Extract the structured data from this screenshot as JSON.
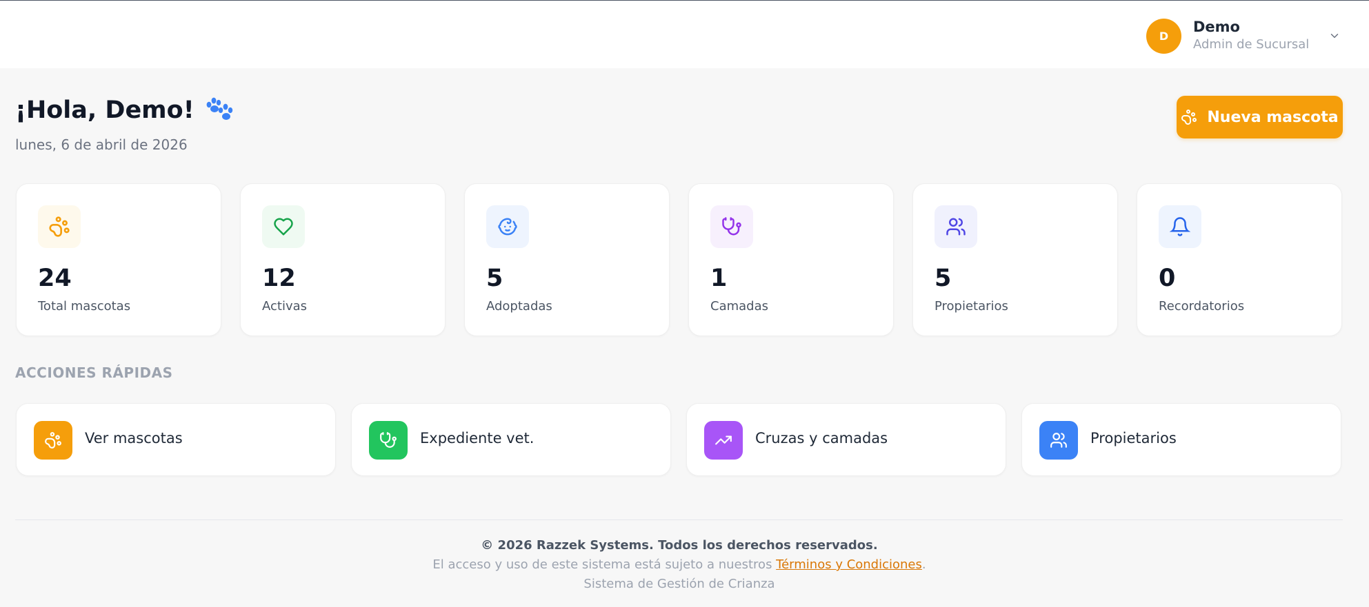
{
  "user": {
    "initial": "D",
    "name": "Demo",
    "role": "Admin de Sucursal"
  },
  "header": {
    "greeting": "¡Hola, Demo!",
    "date": "lunes, 6 de abril de 2026",
    "new_button_label": "Nueva mascota"
  },
  "stats": [
    {
      "value": "24",
      "label": "Total mascotas",
      "icon": "paw-icon",
      "color": "#f59e0b",
      "bg": "#fef9ec"
    },
    {
      "value": "12",
      "label": "Activas",
      "icon": "heart-icon",
      "color": "#16a34a",
      "bg": "#effaf2"
    },
    {
      "value": "5",
      "label": "Adoptadas",
      "icon": "baby-face-icon",
      "color": "#3b82f6",
      "bg": "#eef4fe"
    },
    {
      "value": "1",
      "label": "Camadas",
      "icon": "stethoscope-icon",
      "color": "#9333ea",
      "bg": "#f7f0fd"
    },
    {
      "value": "5",
      "label": "Propietarios",
      "icon": "users-icon",
      "color": "#4f46e5",
      "bg": "#f0f1fd"
    },
    {
      "value": "0",
      "label": "Recordatorios",
      "icon": "bell-icon",
      "color": "#2563eb",
      "bg": "#eef4fe"
    }
  ],
  "quick_actions": {
    "title": "ACCIONES RÁPIDAS",
    "items": [
      {
        "label": "Ver mascotas",
        "icon": "paw-icon",
        "color": "#f59e0b"
      },
      {
        "label": "Expediente vet.",
        "icon": "stethoscope-icon",
        "color": "#22c55e"
      },
      {
        "label": "Cruzas y camadas",
        "icon": "trending-up-icon",
        "color": "#a855f7"
      },
      {
        "label": "Propietarios",
        "icon": "users-icon",
        "color": "#3b82f6"
      }
    ]
  },
  "footer": {
    "copyright": "© 2026 Razzek Systems. Todos los derechos reservados.",
    "terms_prefix": "El acceso y uso de este sistema está sujeto a nuestros ",
    "terms_link": "Términos y Condiciones",
    "terms_suffix": ".",
    "system": "Sistema de Gestión de Crianza"
  }
}
